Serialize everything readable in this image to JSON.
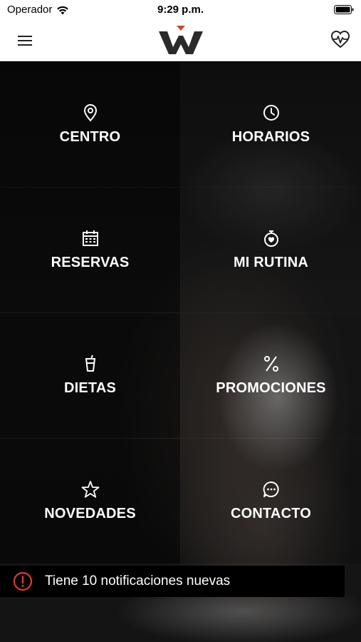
{
  "status_bar": {
    "carrier": "Operador",
    "time": "9:29 p.m."
  },
  "nav": {
    "menu_icon": "hamburger-menu-icon",
    "logo_icon": "brand-w-logo",
    "heart_icon": "heart-rate-icon"
  },
  "menu": {
    "items": [
      {
        "label": "CENTRO",
        "icon": "location-pin-icon"
      },
      {
        "label": "HORARIOS",
        "icon": "clock-icon"
      },
      {
        "label": "RESERVAS",
        "icon": "calendar-icon"
      },
      {
        "label": "MI RUTINA",
        "icon": "stopwatch-heart-icon"
      },
      {
        "label": "DIETAS",
        "icon": "drink-cup-icon"
      },
      {
        "label": "PROMOCIONES",
        "icon": "percent-icon"
      },
      {
        "label": "NOVEDADES",
        "icon": "star-icon"
      },
      {
        "label": "CONTACTO",
        "icon": "chat-bubble-icon"
      }
    ]
  },
  "notification": {
    "text": "Tiene 10 notificaciones nuevas",
    "icon": "alert-circle-icon"
  },
  "colors": {
    "accent": "#e03a2a",
    "logo": "#2a2a2a"
  }
}
